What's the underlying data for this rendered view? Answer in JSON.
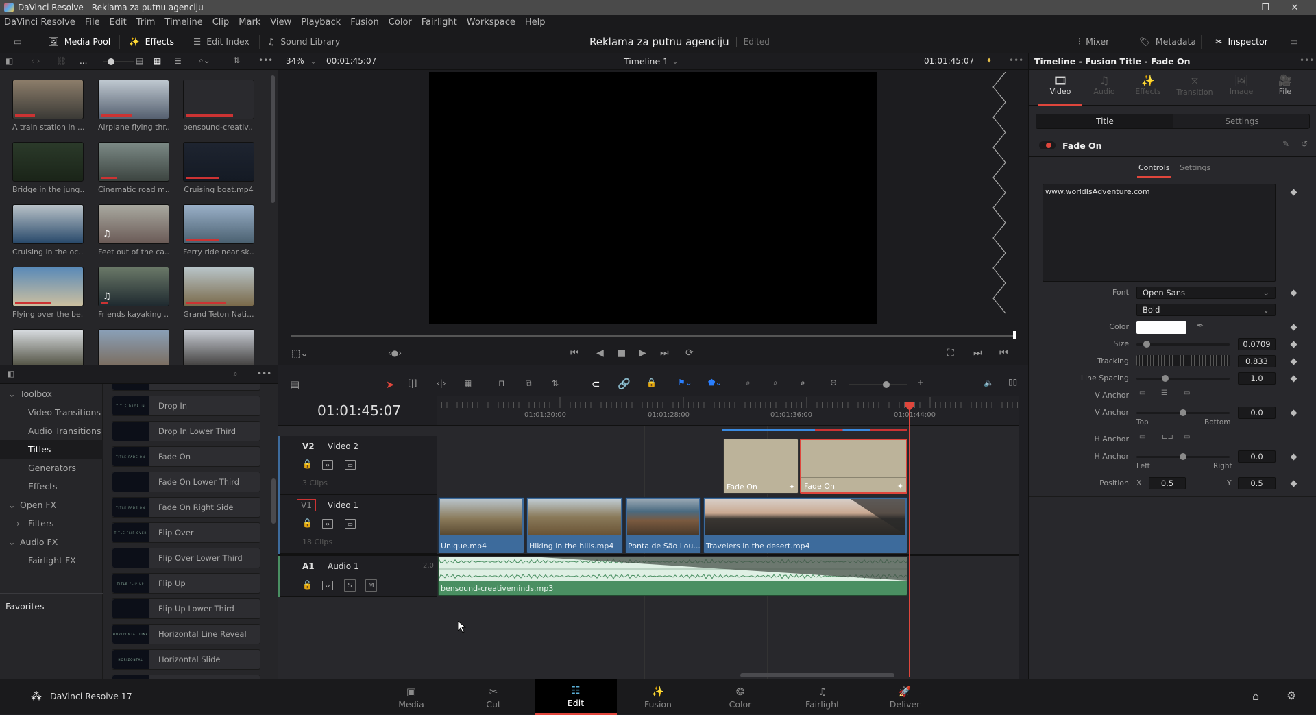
{
  "window": {
    "title": "DaVinci Resolve - Reklama za putnu agenciju",
    "minimize": "–",
    "maximize": "❐",
    "close": "✕"
  },
  "menu": [
    "DaVinci Resolve",
    "File",
    "Edit",
    "Trim",
    "Timeline",
    "Clip",
    "Mark",
    "View",
    "Playback",
    "Fusion",
    "Color",
    "Fairlight",
    "Workspace",
    "Help"
  ],
  "toolbar": {
    "media_pool": "Media Pool",
    "effects": "Effects",
    "edit_index": "Edit Index",
    "sound_library": "Sound Library",
    "project_title": "Reklama za putnu agenciju",
    "project_status": "Edited",
    "mixer": "Mixer",
    "metadata": "Metadata",
    "inspector": "Inspector"
  },
  "subbar": {
    "more_dots": "...",
    "zoom": "34%",
    "source_timecode": "00:01:45:07",
    "timeline_name": "Timeline 1",
    "record_timecode": "01:01:45:07"
  },
  "media_pool": {
    "clips": [
      {
        "label": "A train station in ...",
        "colors": [
          "#8c7d6a",
          "#3b3a36"
        ],
        "progress": 0.3,
        "audio": false
      },
      {
        "label": "Airplane flying thr...",
        "colors": [
          "#bfc8d0",
          "#556070"
        ],
        "progress": 0.48,
        "audio": false
      },
      {
        "label": "bensound-creativ...",
        "colors": [
          "#2a2a2e",
          "#2a2a2e"
        ],
        "progress": 0.72,
        "audio": false
      },
      {
        "label": "Bridge in the jung...",
        "colors": [
          "#2b3a2a",
          "#1a2418"
        ],
        "progress": 0,
        "audio": false
      },
      {
        "label": "Cinematic road m...",
        "colors": [
          "#7c8a86",
          "#3c4440"
        ],
        "progress": 0.24,
        "audio": false
      },
      {
        "label": "Cruising boat.mp4",
        "colors": [
          "#1e2430",
          "#141a24"
        ],
        "progress": 0.5,
        "audio": false
      },
      {
        "label": "Cruising in the oc...",
        "colors": [
          "#b9c2c8",
          "#27486a"
        ],
        "progress": 0,
        "audio": false
      },
      {
        "label": "Feet out of the ca...",
        "colors": [
          "#a9a9a0",
          "#6a5a56"
        ],
        "progress": 0,
        "audio": true
      },
      {
        "label": "Ferry ride near sk...",
        "colors": [
          "#9ab0c8",
          "#4a6070"
        ],
        "progress": 0.5,
        "audio": false
      },
      {
        "label": "Flying over the be...",
        "colors": [
          "#5a8ab8",
          "#cbbfa0"
        ],
        "progress": 0.55,
        "audio": false
      },
      {
        "label": "Friends kayaking ...",
        "colors": [
          "#6a7868",
          "#1f2a30"
        ],
        "progress": 0.1,
        "audio": true
      },
      {
        "label": "Grand Teton Nati...",
        "colors": [
          "#b8c4c8",
          "#7a6a4a"
        ],
        "progress": 0.6,
        "audio": false
      },
      {
        "label": "",
        "colors": [
          "#d8dce0",
          "#4a4a3a"
        ],
        "progress": 0,
        "audio": false
      },
      {
        "label": "",
        "colors": [
          "#8aa0b8",
          "#7a6a5a"
        ],
        "progress": 0,
        "audio": false
      },
      {
        "label": "",
        "colors": [
          "#c8ccd4",
          "#3a3836"
        ],
        "progress": 0,
        "audio": false
      }
    ]
  },
  "effects_tree": [
    {
      "label": "Toolbox",
      "chevron": "⌄",
      "level": 0
    },
    {
      "label": "Video Transitions",
      "level": 1
    },
    {
      "label": "Audio Transitions",
      "level": 1
    },
    {
      "label": "Titles",
      "level": 1,
      "selected": true
    },
    {
      "label": "Generators",
      "level": 1
    },
    {
      "label": "Effects",
      "level": 1
    },
    {
      "label": "Open FX",
      "chevron": "⌄",
      "level": 0
    },
    {
      "label": "Filters",
      "chevron": "›",
      "level": 1
    },
    {
      "label": "Audio FX",
      "chevron": "⌄",
      "level": 0
    },
    {
      "label": "Fairlight FX",
      "level": 1
    }
  ],
  "favorites": "Favorites",
  "effects_list": [
    {
      "name": "",
      "thumb": ""
    },
    {
      "name": "Drop In",
      "thumb": "TITLE DROP IN"
    },
    {
      "name": "Drop In Lower Third",
      "thumb": ""
    },
    {
      "name": "Fade On",
      "thumb": "TITLE FADE ON"
    },
    {
      "name": "Fade On Lower Third",
      "thumb": ""
    },
    {
      "name": "Fade On Right Side",
      "thumb": "TITLE FADE ON"
    },
    {
      "name": "Flip Over",
      "thumb": "TITLE FLIP OVER"
    },
    {
      "name": "Flip Over Lower Third",
      "thumb": ""
    },
    {
      "name": "Flip Up",
      "thumb": "TITLE FLIP UP"
    },
    {
      "name": "Flip Up Lower Third",
      "thumb": ""
    },
    {
      "name": "Horizontal Line Reveal",
      "thumb": "HORIZONTAL LINE"
    },
    {
      "name": "Horizontal Slide",
      "thumb": "HORIZONTAL"
    },
    {
      "name": "",
      "thumb": ""
    }
  ],
  "timeline": {
    "timecode": "01:01:45:07",
    "ruler": [
      "01:01:20:00",
      "01:01:28:00",
      "01:01:36:00",
      "01:01:44:00"
    ],
    "tracks": {
      "v2": {
        "code": "V2",
        "name": "Video 2",
        "count": "3 Clips"
      },
      "v1": {
        "code": "V1",
        "name": "Video 1",
        "count": "18 Clips"
      },
      "a1": {
        "code": "A1",
        "name": "Audio 1",
        "channels": "2.0",
        "solo": "S",
        "mute": "M"
      }
    },
    "title_clips": [
      "Fade On",
      "Fade On"
    ],
    "video_clips": [
      "Unique.mp4",
      "Hiking in the hills.mp4",
      "Ponta de São Lou...",
      "Travelers in the desert.mp4"
    ],
    "audio_clip": "bensound-creativeminds.mp3"
  },
  "inspector": {
    "header": "Timeline - Fusion Title - Fade On",
    "tabs": [
      "Video",
      "Audio",
      "Effects",
      "Transition",
      "Image",
      "File"
    ],
    "subtabs": [
      "Title",
      "Settings"
    ],
    "section": "Fade On",
    "section_tabs": [
      "Controls",
      "Settings"
    ],
    "text": "www.worldIsAdventure.com",
    "font_label": "Font",
    "font": "Open Sans",
    "style": "Bold",
    "color_label": "Color",
    "color_value": "#ffffff",
    "size_label": "Size",
    "size": "0.0709",
    "size_fraction": 0.07,
    "tracking_label": "Tracking",
    "tracking": "0.833",
    "line_spacing_label": "Line Spacing",
    "line_spacing": "1.0",
    "line_spacing_fraction": 0.27,
    "v_anchor_label": "V Anchor",
    "v_anchor": "0.0",
    "v_top": "Top",
    "v_bottom": "Bottom",
    "h_anchor_label": "H Anchor",
    "h_anchor": "0.0",
    "h_left": "Left",
    "h_right": "Right",
    "position_label": "Position",
    "x_label": "X",
    "pos_x": "0.5",
    "y_label": "Y",
    "pos_y": "0.5"
  },
  "pages": [
    "Media",
    "Cut",
    "Edit",
    "Fusion",
    "Color",
    "Fairlight",
    "Deliver"
  ],
  "active_page": "Edit",
  "product": "DaVinci Resolve 17",
  "colors": {
    "accent": "#e0463c",
    "video_clip": "#3d6b9c",
    "audio_clip": "#4a8f62",
    "title_clip": "#bcb39a"
  }
}
